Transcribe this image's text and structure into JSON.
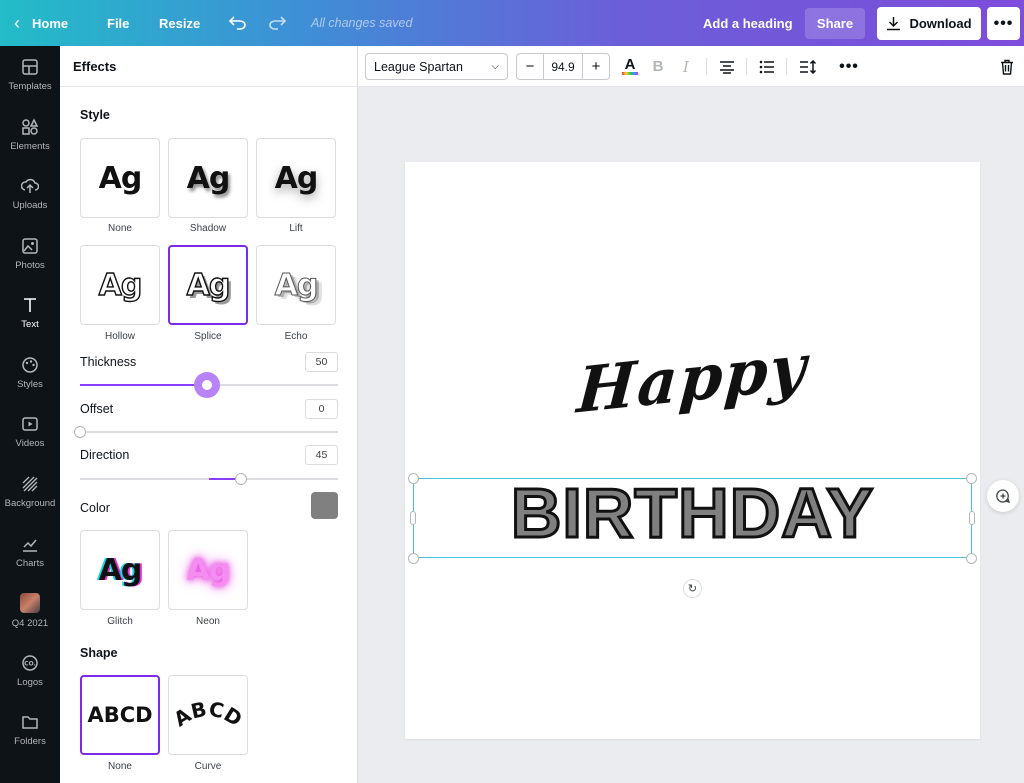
{
  "topbar": {
    "home": "Home",
    "file": "File",
    "resize": "Resize",
    "saved_status": "All changes saved",
    "add_heading": "Add a heading",
    "share": "Share",
    "download": "Download"
  },
  "rail": {
    "items": [
      {
        "label": "Templates",
        "icon": "templates-icon"
      },
      {
        "label": "Elements",
        "icon": "elements-icon"
      },
      {
        "label": "Uploads",
        "icon": "uploads-icon"
      },
      {
        "label": "Photos",
        "icon": "photos-icon"
      },
      {
        "label": "Text",
        "icon": "text-icon",
        "active": true
      },
      {
        "label": "Styles",
        "icon": "styles-icon"
      },
      {
        "label": "Videos",
        "icon": "videos-icon"
      },
      {
        "label": "Background",
        "icon": "background-icon"
      },
      {
        "label": "Charts",
        "icon": "charts-icon"
      },
      {
        "label": "Q4 2021",
        "icon": "folder-thumbnail"
      },
      {
        "label": "Logos",
        "icon": "logos-icon"
      },
      {
        "label": "Folders",
        "icon": "folders-icon"
      }
    ]
  },
  "panel": {
    "title": "Effects",
    "style_title": "Style",
    "styles": [
      {
        "label": "None",
        "sample": "Ag"
      },
      {
        "label": "Shadow",
        "sample": "Ag"
      },
      {
        "label": "Lift",
        "sample": "Ag"
      },
      {
        "label": "Hollow",
        "sample": "Ag"
      },
      {
        "label": "Splice",
        "sample": "Ag",
        "selected": true
      },
      {
        "label": "Echo",
        "sample": "Ag"
      },
      {
        "label": "Glitch",
        "sample": "Ag"
      },
      {
        "label": "Neon",
        "sample": "Ag"
      }
    ],
    "thickness": {
      "label": "Thickness",
      "value": "50"
    },
    "offset": {
      "label": "Offset",
      "value": "0"
    },
    "direction": {
      "label": "Direction",
      "value": "45"
    },
    "color": {
      "label": "Color",
      "value": "#808080"
    },
    "shape_title": "Shape",
    "shapes": [
      {
        "label": "None",
        "sample": "ABCD",
        "selected": true
      },
      {
        "label": "Curve",
        "sample": "ABCD"
      }
    ]
  },
  "text_toolbar": {
    "font": "League Spartan",
    "font_size": "94.9",
    "decrease": "−",
    "increase": "+",
    "text_color_glyph": "A",
    "bold_glyph": "B",
    "italic_glyph": "I"
  },
  "canvas": {
    "line1": "Happy",
    "line2": "BIRTHDAY"
  },
  "colors": {
    "accent": "#7d2ae8",
    "selection": "#45c5d6",
    "splice_color": "#808080"
  }
}
